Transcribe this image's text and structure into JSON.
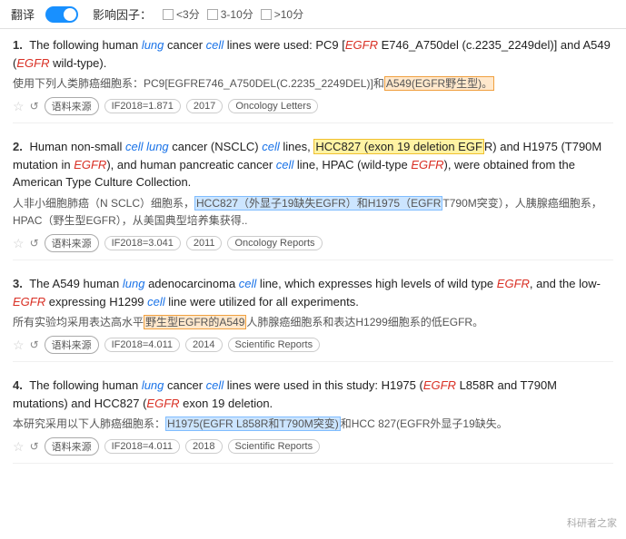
{
  "topbar": {
    "translate_label": "翻译",
    "toggle_state": "on",
    "influence_label": "影响因子：",
    "filters": [
      {
        "label": "<3分",
        "checked": false
      },
      {
        "label": "3-10分",
        "checked": false
      },
      {
        " label": ">10分",
        "checked": false
      }
    ]
  },
  "results": [
    {
      "number": "1.",
      "en_parts": [
        {
          "text": "The following human ",
          "type": "normal"
        },
        {
          "text": "lung",
          "type": "italic-blue"
        },
        {
          "text": " cancer ",
          "type": "normal"
        },
        {
          "text": "cell",
          "type": "italic-blue"
        },
        {
          "text": " lines were used: PC9 [",
          "type": "normal"
        },
        {
          "text": "EGFR",
          "type": "italic-red"
        },
        {
          "text": " E746_A750del (c.2235_2249del)] and A549 (",
          "type": "normal"
        },
        {
          "text": "EGFR",
          "type": "italic-red"
        },
        {
          "text": " wild-type).",
          "type": "normal"
        }
      ],
      "cn_parts": [
        {
          "text": "使用下列人类肺癌细胞系：PC9[EGFRE746_A750DEL(C.2235_2249DEL)]和",
          "type": "normal"
        },
        {
          "text": "A549(EGFR野生型)。",
          "type": "highlight-cn-orange"
        }
      ],
      "footer": {
        "if_value": "IF2018=1.871",
        "year": "2017",
        "journal": "Oncology Letters"
      }
    },
    {
      "number": "2.",
      "en_parts": [
        {
          "text": "Human non-small ",
          "type": "normal"
        },
        {
          "text": "cell lung",
          "type": "italic-blue"
        },
        {
          "text": " cancer (NSCLC) ",
          "type": "normal"
        },
        {
          "text": "cell",
          "type": "italic-blue"
        },
        {
          "text": " lines, ",
          "type": "normal"
        },
        {
          "text": "HCC827 (exon 19 deletion EGF",
          "type": "highlight-yellow"
        },
        {
          "text": "R) and H1975 (T790M mutation in ",
          "type": "normal"
        },
        {
          "text": "EGFR",
          "type": "italic-red"
        },
        {
          "text": "), and human pancreatic cancer ",
          "type": "normal"
        },
        {
          "text": "cell",
          "type": "italic-blue"
        },
        {
          "text": " line, HPAC (wild-type ",
          "type": "normal"
        },
        {
          "text": "EGFR",
          "type": "italic-red"
        },
        {
          "text": "), were obtained from the American Type Culture Collection.",
          "type": "normal"
        }
      ],
      "cn_parts": [
        {
          "text": "人非小细胞肺癌（N SCLC）细胞系，",
          "type": "normal"
        },
        {
          "text": "HCC827（外显子19缺失EGFR）和H1975（EGFR",
          "type": "highlight-cn-blue"
        },
        {
          "text": "T790M突变），人胰腺癌细胞系，HPAC（野生型EGFR），从美国典型培养集获得..",
          "type": "normal"
        }
      ],
      "footer": {
        "if_value": "IF2018=3.041",
        "year": "2011",
        "journal": "Oncology Reports"
      }
    },
    {
      "number": "3.",
      "en_parts": [
        {
          "text": "The A549 human ",
          "type": "normal"
        },
        {
          "text": "lung",
          "type": "italic-blue"
        },
        {
          "text": " adenocarcinoma ",
          "type": "normal"
        },
        {
          "text": "cell",
          "type": "italic-blue"
        },
        {
          "text": " line, which expresses high levels of wild type ",
          "type": "normal"
        },
        {
          "text": "EGFR",
          "type": "italic-red"
        },
        {
          "text": ", and the low-",
          "type": "normal"
        },
        {
          "text": "EGFR",
          "type": "italic-red"
        },
        {
          "text": " expressing H1299 ",
          "type": "normal"
        },
        {
          "text": "cell",
          "type": "italic-blue"
        },
        {
          "text": " line were utilized for all experiments.",
          "type": "normal"
        }
      ],
      "cn_parts": [
        {
          "text": "所有实验均采用表达高水平",
          "type": "normal"
        },
        {
          "text": "野生型EGFR的A549",
          "type": "highlight-cn-orange"
        },
        {
          "text": "人肺腺癌细胞系和表达H1299细胞系的低EGFR。",
          "type": "normal"
        }
      ],
      "footer": {
        "if_value": "IF2018=4.011",
        "year": "2014",
        "journal": "Scientific Reports"
      }
    },
    {
      "number": "4.",
      "en_parts": [
        {
          "text": "The following human ",
          "type": "normal"
        },
        {
          "text": "lung",
          "type": "italic-blue"
        },
        {
          "text": " cancer ",
          "type": "normal"
        },
        {
          "text": "cell",
          "type": "italic-blue"
        },
        {
          "text": " lines were used in this study: H1975 (",
          "type": "normal"
        },
        {
          "text": "EGFR",
          "type": "italic-red"
        },
        {
          "text": " L858R and T790M mutations) and HCC827 (",
          "type": "normal"
        },
        {
          "text": "EGFR",
          "type": "italic-red"
        },
        {
          "text": " exon 19 deletion.",
          "type": "normal"
        }
      ],
      "cn_parts": [
        {
          "text": "本研究采用以下人肺癌细胞系：",
          "type": "normal"
        },
        {
          "text": "H1975(EGFR L858R和T790M突变)",
          "type": "highlight-cn-blue"
        },
        {
          "text": "和HCC 827(EGFR外显子19缺失。",
          "type": "normal"
        }
      ],
      "footer": {
        "if_value": "IF2018=4.011",
        "year": "2018",
        "journal": "Scientific Reports"
      }
    }
  ],
  "watermark": "科研者之家"
}
